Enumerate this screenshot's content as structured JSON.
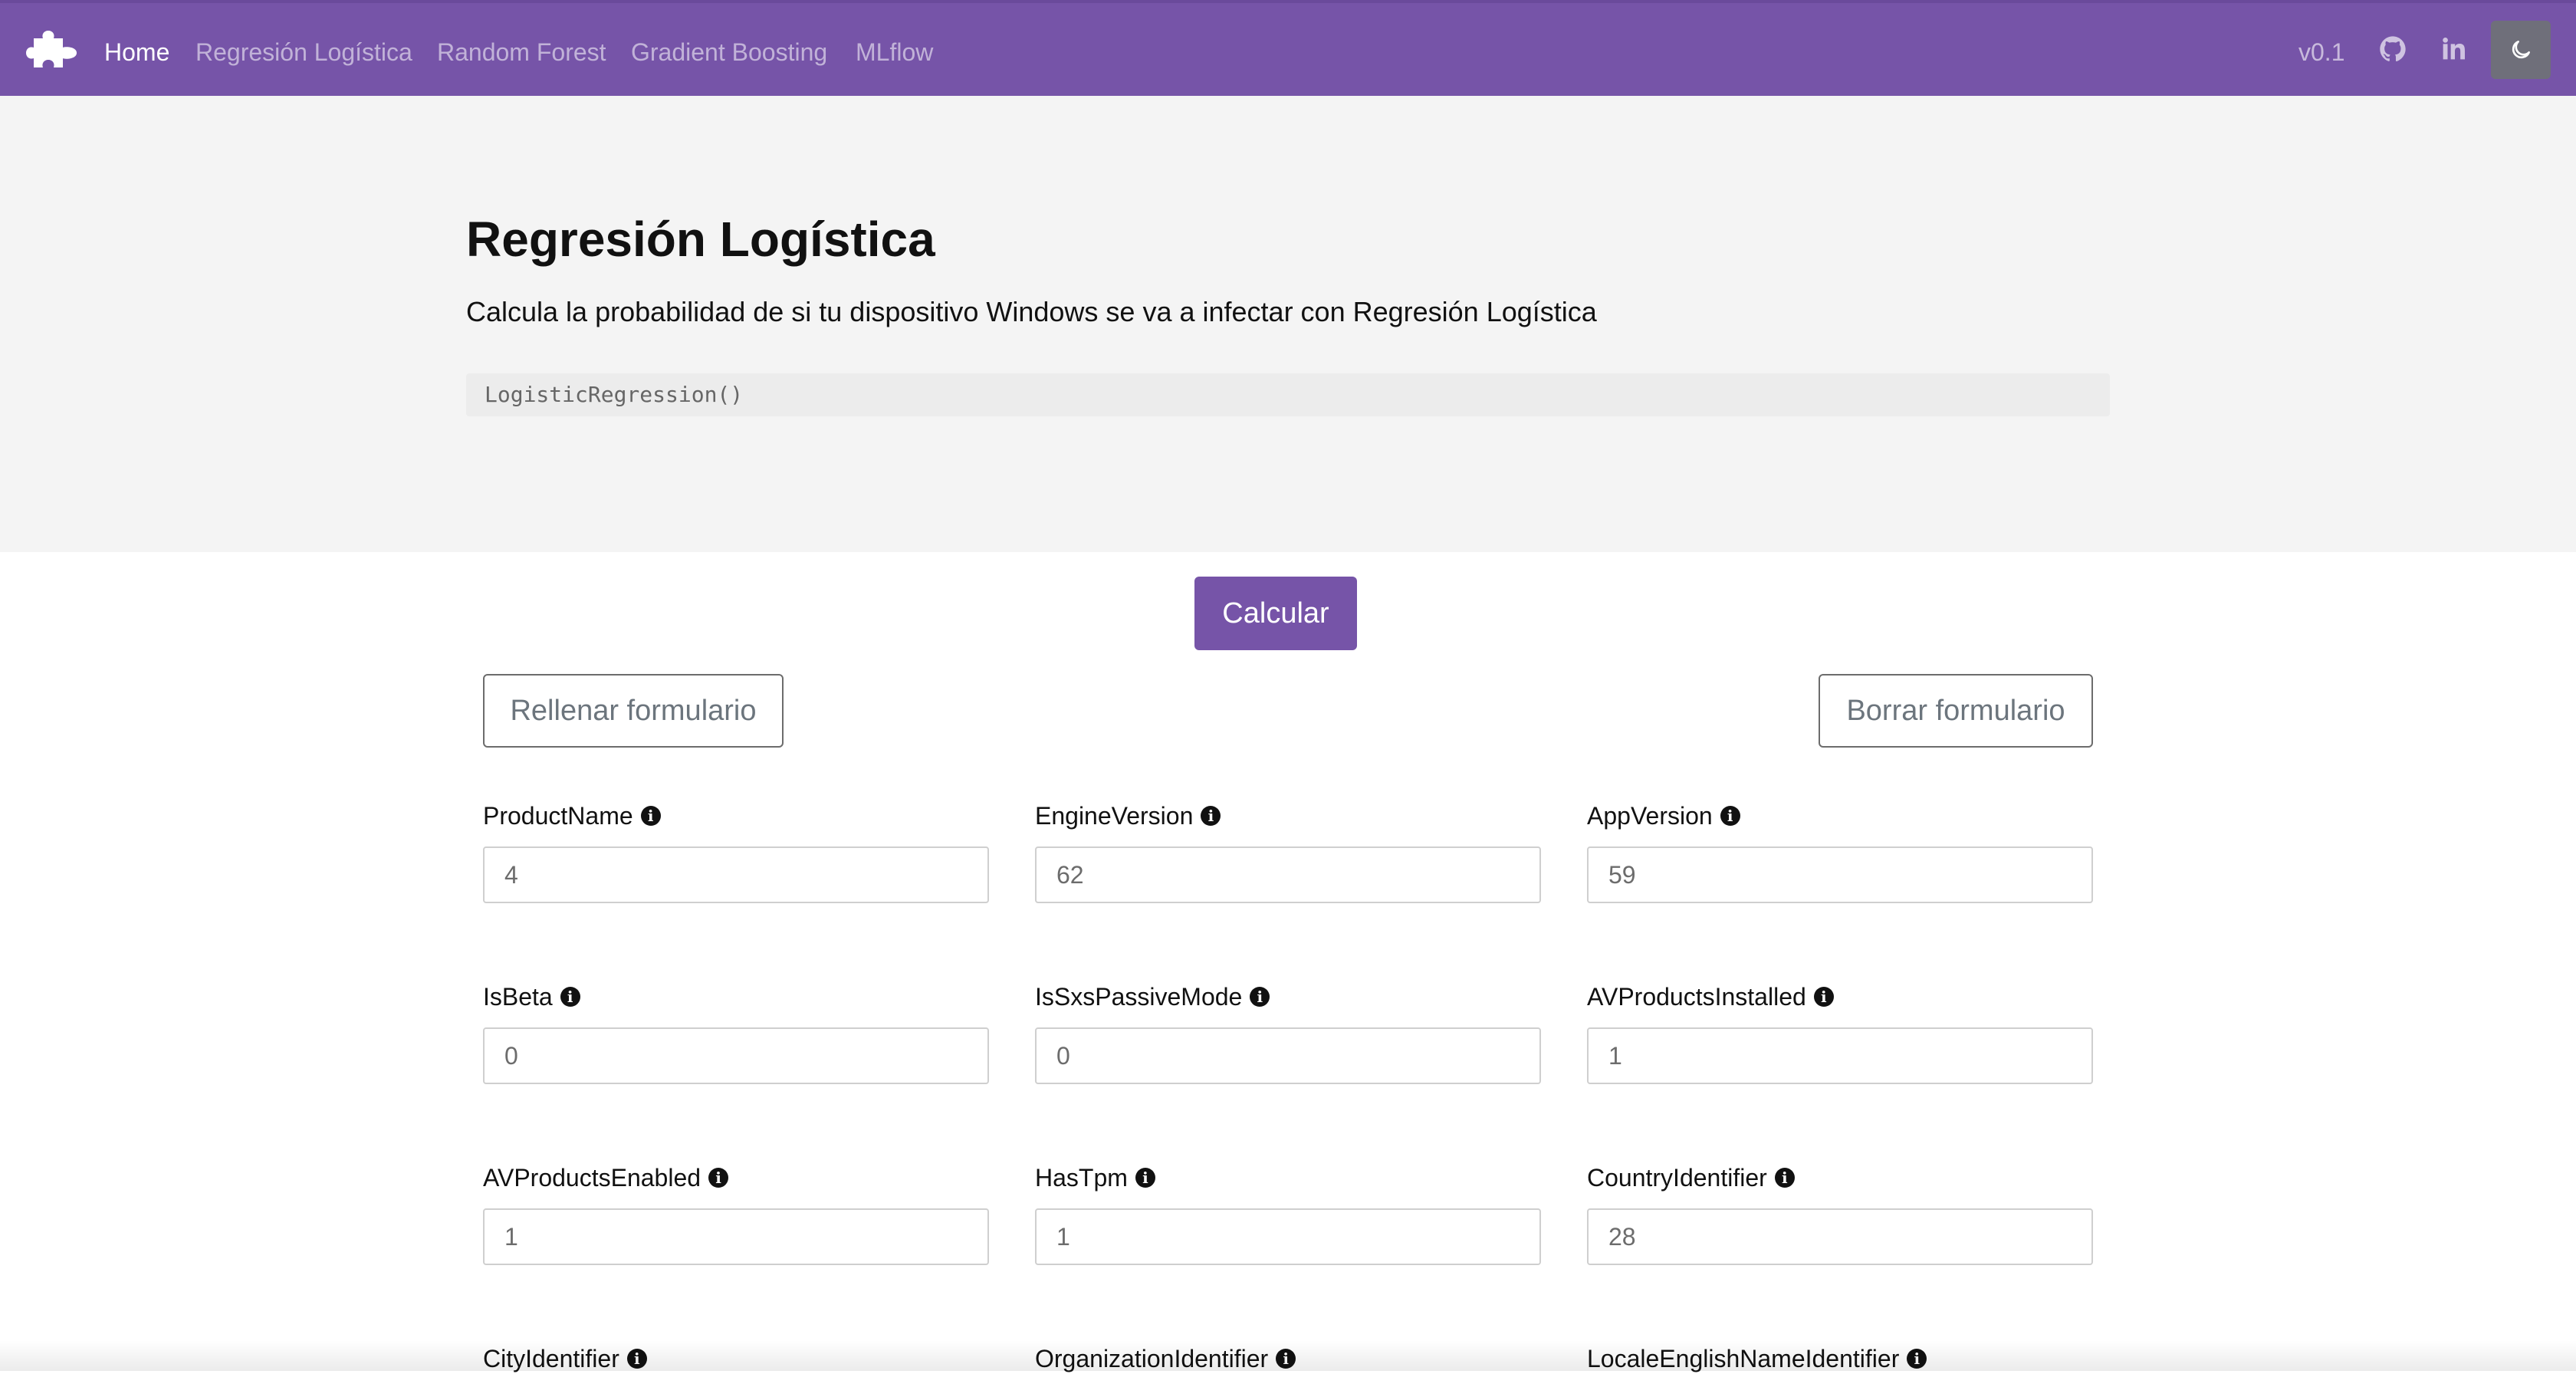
{
  "navbar": {
    "brand_icon": "puzzle-icon",
    "links": [
      {
        "label": "Home",
        "active": true
      },
      {
        "label": "Regresión Logística",
        "active": false
      },
      {
        "label": "Random Forest",
        "active": false
      },
      {
        "label": "Gradient Boosting",
        "active": false
      },
      {
        "label": "MLflow",
        "active": false
      }
    ],
    "version": "v0.1",
    "icons": [
      "github-icon",
      "linkedin-icon",
      "moon-icon"
    ]
  },
  "hero": {
    "title": "Regresión Logística",
    "subtitle": "Calcula la probabilidad de si tu dispositivo Windows se va a infectar con Regresión Logística",
    "code": "LogisticRegression()"
  },
  "actions": {
    "calculate": "Calcular",
    "fill": "Rellenar formulario",
    "clear": "Borrar formulario"
  },
  "form": {
    "fields": [
      {
        "label": "ProductName",
        "value": "4"
      },
      {
        "label": "EngineVersion",
        "value": "62"
      },
      {
        "label": "AppVersion",
        "value": "59"
      },
      {
        "label": "IsBeta",
        "value": "0"
      },
      {
        "label": "IsSxsPassiveMode",
        "value": "0"
      },
      {
        "label": "AVProductsInstalled",
        "value": "1"
      },
      {
        "label": "AVProductsEnabled",
        "value": "1"
      },
      {
        "label": "HasTpm",
        "value": "1"
      },
      {
        "label": "CountryIdentifier",
        "value": "28"
      },
      {
        "label": "CityIdentifier",
        "value": ""
      },
      {
        "label": "OrganizationIdentifier",
        "value": ""
      },
      {
        "label": "LocaleEnglishNameIdentifier",
        "value": ""
      }
    ]
  },
  "colors": {
    "brand": "#7654a8",
    "hero_bg": "#f4f4f4",
    "outline": "#6c757d"
  }
}
